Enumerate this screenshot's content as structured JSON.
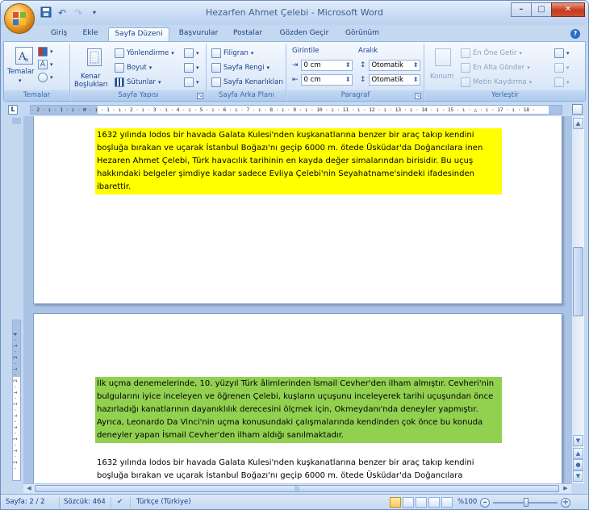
{
  "window": {
    "title": "Hezarfen Ahmet Çelebi - Microsoft Word",
    "controls": {
      "minimize": "–",
      "maximize": "□",
      "close": "✕"
    }
  },
  "quick_access": {
    "save_icon": "save-icon",
    "undo_icon": "undo-icon",
    "redo_icon": "redo-icon"
  },
  "tabs": [
    {
      "label": "Giriş",
      "active": false
    },
    {
      "label": "Ekle",
      "active": false
    },
    {
      "label": "Sayfa Düzeni",
      "active": true
    },
    {
      "label": "Başvurular",
      "active": false
    },
    {
      "label": "Postalar",
      "active": false
    },
    {
      "label": "Gözden Geçir",
      "active": false
    },
    {
      "label": "Görünüm",
      "active": false
    }
  ],
  "ribbon": {
    "temalar": {
      "group_label": "Temalar",
      "button_label": "Temalar"
    },
    "sayfa_yapisi": {
      "group_label": "Sayfa Yapısı",
      "kenar_line1": "Kenar",
      "kenar_line2": "Boşlukları",
      "yonlendirme": "Yönlendirme",
      "boyut": "Boyut",
      "sutunlar": "Sütunlar"
    },
    "sayfa_arka_plani": {
      "group_label": "Sayfa Arka Planı",
      "filigran": "Filigran",
      "sayfa_rengi": "Sayfa Rengi",
      "sayfa_kenarliklari": "Sayfa Kenarlıkları"
    },
    "paragraf": {
      "group_label": "Paragraf",
      "girintile": "Girintile",
      "aralik": "Aralık",
      "girinti_sol": "0 cm",
      "girinti_sag": "0 cm",
      "aralik_once": "Otomatik",
      "aralik_sonra": "Otomatik"
    },
    "yerlestir": {
      "group_label": "Yerleştir",
      "konum": "Konum",
      "en_one_getir": "En Öne Getir",
      "en_alta_gonder": "En Alta Gönder",
      "metin_kaydirma": "Metin Kaydırma"
    }
  },
  "ruler": {
    "corner": "L",
    "ticks": "· 2 · ı · 1 · ı · ⊠ · ı · 1 · ı · 2 · ı · 3 · ı · 4 · ı · 5 · ı · 6 · ı · 7 · ı · 8 · ı · 9 · ı · 10 · ı · 11 · ı · 12 · ı · 13 · ı · 14 · ı · 15 · ı · △ · ı · 17 · ı · 18 ·",
    "vticks": "· 2 · ı · 1 · ı · ı · 1 · ı · 2 · ı · 3 · ı · 4"
  },
  "document": {
    "para_yellow": "1632 yılında lodos bir havada Galata Kulesi'nden kuşkanatlarına benzer bir araç takıp kendini boşluğa bırakan ve uçarak İstanbul Boğazı'nı geçip 6000 m. ötede Üsküdar'da Doğancılara inen Hezaren Ahmet Çelebi, Türk havacılık tarihinin en kayda değer simalarından birisidir. Bu uçuş hakkındaki belgeler şimdiye kadar sadece Evliya Çelebi'nin Seyahatname'sindeki ifadesinden ibarettir.",
    "para_green": "İlk uçma denemelerinde, 10. yüzyıl Türk âlimlerinden İsmail Cevher'den ilham almıştır. Cevheri'nin bulgularını iyice inceleyen ve öğrenen Çelebi, kuşların uçuşunu inceleyerek tarihi uçuşundan önce hazırladığı kanatlarının dayanıklılık derecesini ölçmek için, Okmeydanı'nda deneyler yapmıştır. Ayrıca, Leonardo Da Vinci'nin uçma konusundaki çalışmalarında kendinden çok önce bu konuda deneyler yapan İsmail Cevher'den ilham aldığı sanılmaktadır.",
    "para_plain": "1632 yılında lodos bir havada Galata Kulesi'nden kuşkanatlarına benzer bir araç takıp kendini boşluğa bırakan ve uçarak İstanbul Boğazı'nı geçip 6000 m. ötede Üsküdar'da Doğancılara"
  },
  "colors": {
    "highlight_yellow": "#ffff00",
    "highlight_green": "#92d050"
  },
  "statusbar": {
    "page": "Sayfa: 2 / 2",
    "words": "Sözcük: 464",
    "language": "Türkçe (Türkiye)",
    "zoom": "%100"
  }
}
